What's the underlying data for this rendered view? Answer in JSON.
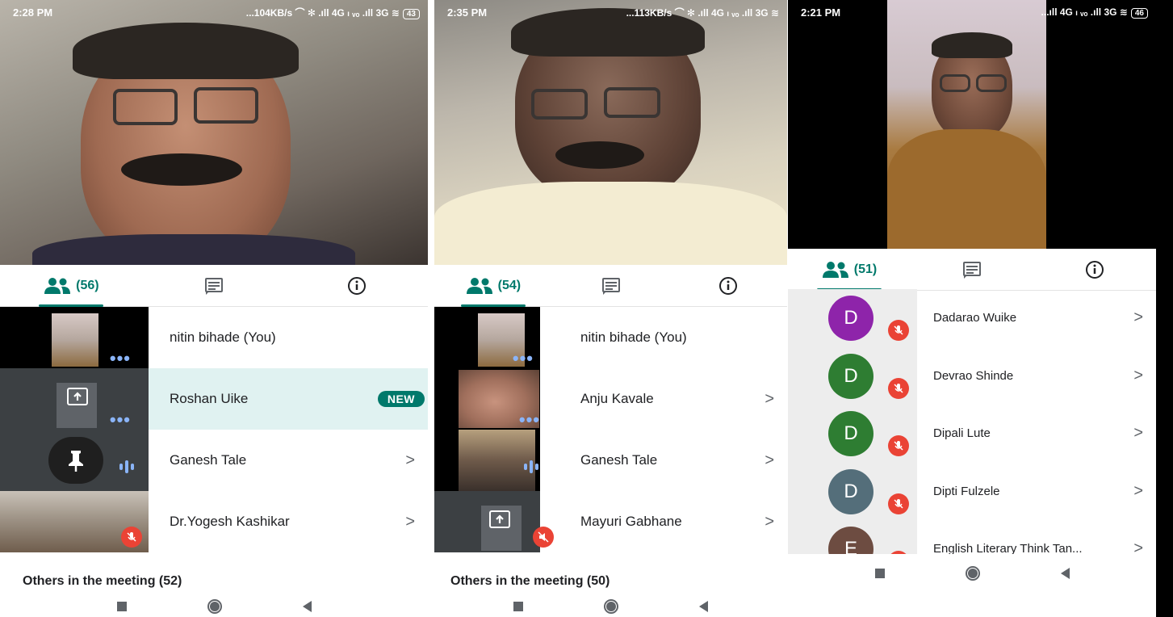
{
  "panels": [
    {
      "id": "p1",
      "status": {
        "time": "2:28 PM",
        "right": "...104KB/s ⌒ ✻ .ıll 4G ₗ ᵥₒ .ıll 3G ≋",
        "battery": "43"
      },
      "tabs": {
        "people_count": "(56)"
      },
      "rows": [
        {
          "name": "nitin bihade (You)",
          "tile": "camera-dots",
          "highlight": false,
          "chevron": ""
        },
        {
          "name": "Roshan Uike",
          "tile": "screen-share",
          "highlight": true,
          "badge": "NEW",
          "chevron": ""
        },
        {
          "name": "Ganesh Tale",
          "tile": "pinned-speaking",
          "highlight": false,
          "chevron": ">"
        },
        {
          "name": "Dr.Yogesh Kashikar",
          "tile": "camera-muted",
          "highlight": false,
          "chevron": ">"
        }
      ],
      "others": "Others in the meeting (52)"
    },
    {
      "id": "p2",
      "status": {
        "time": "2:35 PM",
        "right": "...113KB/s ⌒ ✻ .ıll 4G ₗ ᵥₒ .ıll 3G ≋"
      },
      "tabs": {
        "people_count": "(54)"
      },
      "rows": [
        {
          "name": "nitin bihade (You)",
          "chevron": ""
        },
        {
          "name": "Anju Kavale",
          "chevron": ">"
        },
        {
          "name": "Ganesh Tale",
          "chevron": ">"
        },
        {
          "name": "Mayuri Gabhane",
          "chevron": ">"
        }
      ],
      "others": "Others in the meeting (50)"
    },
    {
      "id": "p3",
      "status": {
        "time": "2:21 PM",
        "right": "...ıll 4G ₗ ᵥₒ .ıll 3G ≋",
        "battery": "46"
      },
      "tabs": {
        "people_count": "(51)"
      },
      "rows": [
        {
          "initial": "D",
          "name": "Dadarao Wuike",
          "color": "#8e24aa",
          "chevron": ">"
        },
        {
          "initial": "D",
          "name": "Devrao Shinde",
          "color": "#2e7d32",
          "chevron": ">"
        },
        {
          "initial": "D",
          "name": "Dipali Lute",
          "color": "#2e7d32",
          "chevron": ">"
        },
        {
          "initial": "D",
          "name": "Dipti Fulzele",
          "color": "#546e7a",
          "chevron": ">"
        },
        {
          "initial": "E",
          "name": "English Literary Think Tan...",
          "color": "#6d4c41",
          "chevron": ">"
        }
      ]
    }
  ],
  "theme": {
    "accent": "#00796b",
    "highlight": "#e0f2f1",
    "mute_red": "#ea4335",
    "audio_blue": "#8ab4f8"
  },
  "icons": [
    "people-icon",
    "chat-icon",
    "info-icon",
    "share-screen-icon",
    "pin-icon",
    "mic-off-icon",
    "audio-level-icon"
  ]
}
